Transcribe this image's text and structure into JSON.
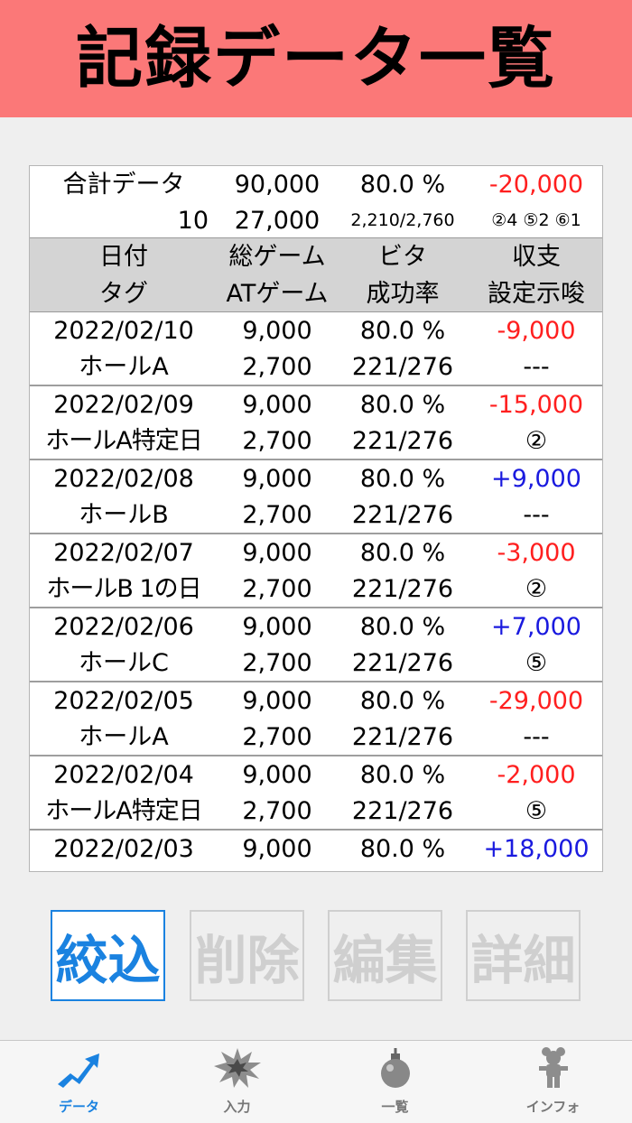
{
  "banner": {
    "title": "記録データ一覧"
  },
  "summary": {
    "line1": [
      "合計データ",
      "90,000",
      "80.0 %",
      "-20,000"
    ],
    "line2": [
      "10",
      "27,000",
      "2,210/2,760",
      "②4 ⑤2 ⑥1"
    ]
  },
  "header": {
    "line1": [
      "日付",
      "総ゲーム",
      "ビタ",
      "収支"
    ],
    "line2": [
      "タグ",
      "ATゲーム",
      "成功率",
      "設定示唆"
    ]
  },
  "records": [
    {
      "date": "2022/02/10",
      "total_games": "9,000",
      "rate": "80.0 %",
      "balance": "-9,000",
      "sign": "neg",
      "tag": "ホールA",
      "at_games": "2,700",
      "ratio": "221/276",
      "hint": "---"
    },
    {
      "date": "2022/02/09",
      "total_games": "9,000",
      "rate": "80.0 %",
      "balance": "-15,000",
      "sign": "neg",
      "tag": "ホールA特定日",
      "at_games": "2,700",
      "ratio": "221/276",
      "hint": "②"
    },
    {
      "date": "2022/02/08",
      "total_games": "9,000",
      "rate": "80.0 %",
      "balance": "+9,000",
      "sign": "pos",
      "tag": "ホールB",
      "at_games": "2,700",
      "ratio": "221/276",
      "hint": "---"
    },
    {
      "date": "2022/02/07",
      "total_games": "9,000",
      "rate": "80.0 %",
      "balance": "-3,000",
      "sign": "neg",
      "tag": "ホールB 1の日",
      "at_games": "2,700",
      "ratio": "221/276",
      "hint": "②"
    },
    {
      "date": "2022/02/06",
      "total_games": "9,000",
      "rate": "80.0 %",
      "balance": "+7,000",
      "sign": "pos",
      "tag": "ホールC",
      "at_games": "2,700",
      "ratio": "221/276",
      "hint": "⑤"
    },
    {
      "date": "2022/02/05",
      "total_games": "9,000",
      "rate": "80.0 %",
      "balance": "-29,000",
      "sign": "neg",
      "tag": "ホールA",
      "at_games": "2,700",
      "ratio": "221/276",
      "hint": "---"
    },
    {
      "date": "2022/02/04",
      "total_games": "9,000",
      "rate": "80.0 %",
      "balance": "-2,000",
      "sign": "neg",
      "tag": "ホールA特定日",
      "at_games": "2,700",
      "ratio": "221/276",
      "hint": "⑤"
    },
    {
      "date": "2022/02/03",
      "total_games": "9,000",
      "rate": "80.0 %",
      "balance": "+18,000",
      "sign": "pos",
      "tag": "",
      "at_games": "",
      "ratio": "",
      "hint": ""
    }
  ],
  "buttons": {
    "filter": "絞込",
    "delete": "削除",
    "edit": "編集",
    "detail": "詳細"
  },
  "tabs": [
    {
      "label": "データ",
      "icon": "chart-arrow-icon",
      "active": true
    },
    {
      "label": "入力",
      "icon": "explosion-icon",
      "active": false
    },
    {
      "label": "一覧",
      "icon": "bomb-icon",
      "active": false
    },
    {
      "label": "インフォ",
      "icon": "person-icon",
      "active": false
    }
  ],
  "colors": {
    "banner": "#fb7878",
    "accent": "#1a82e0",
    "negative": "#ff1f1f",
    "positive": "#1a1adf"
  }
}
